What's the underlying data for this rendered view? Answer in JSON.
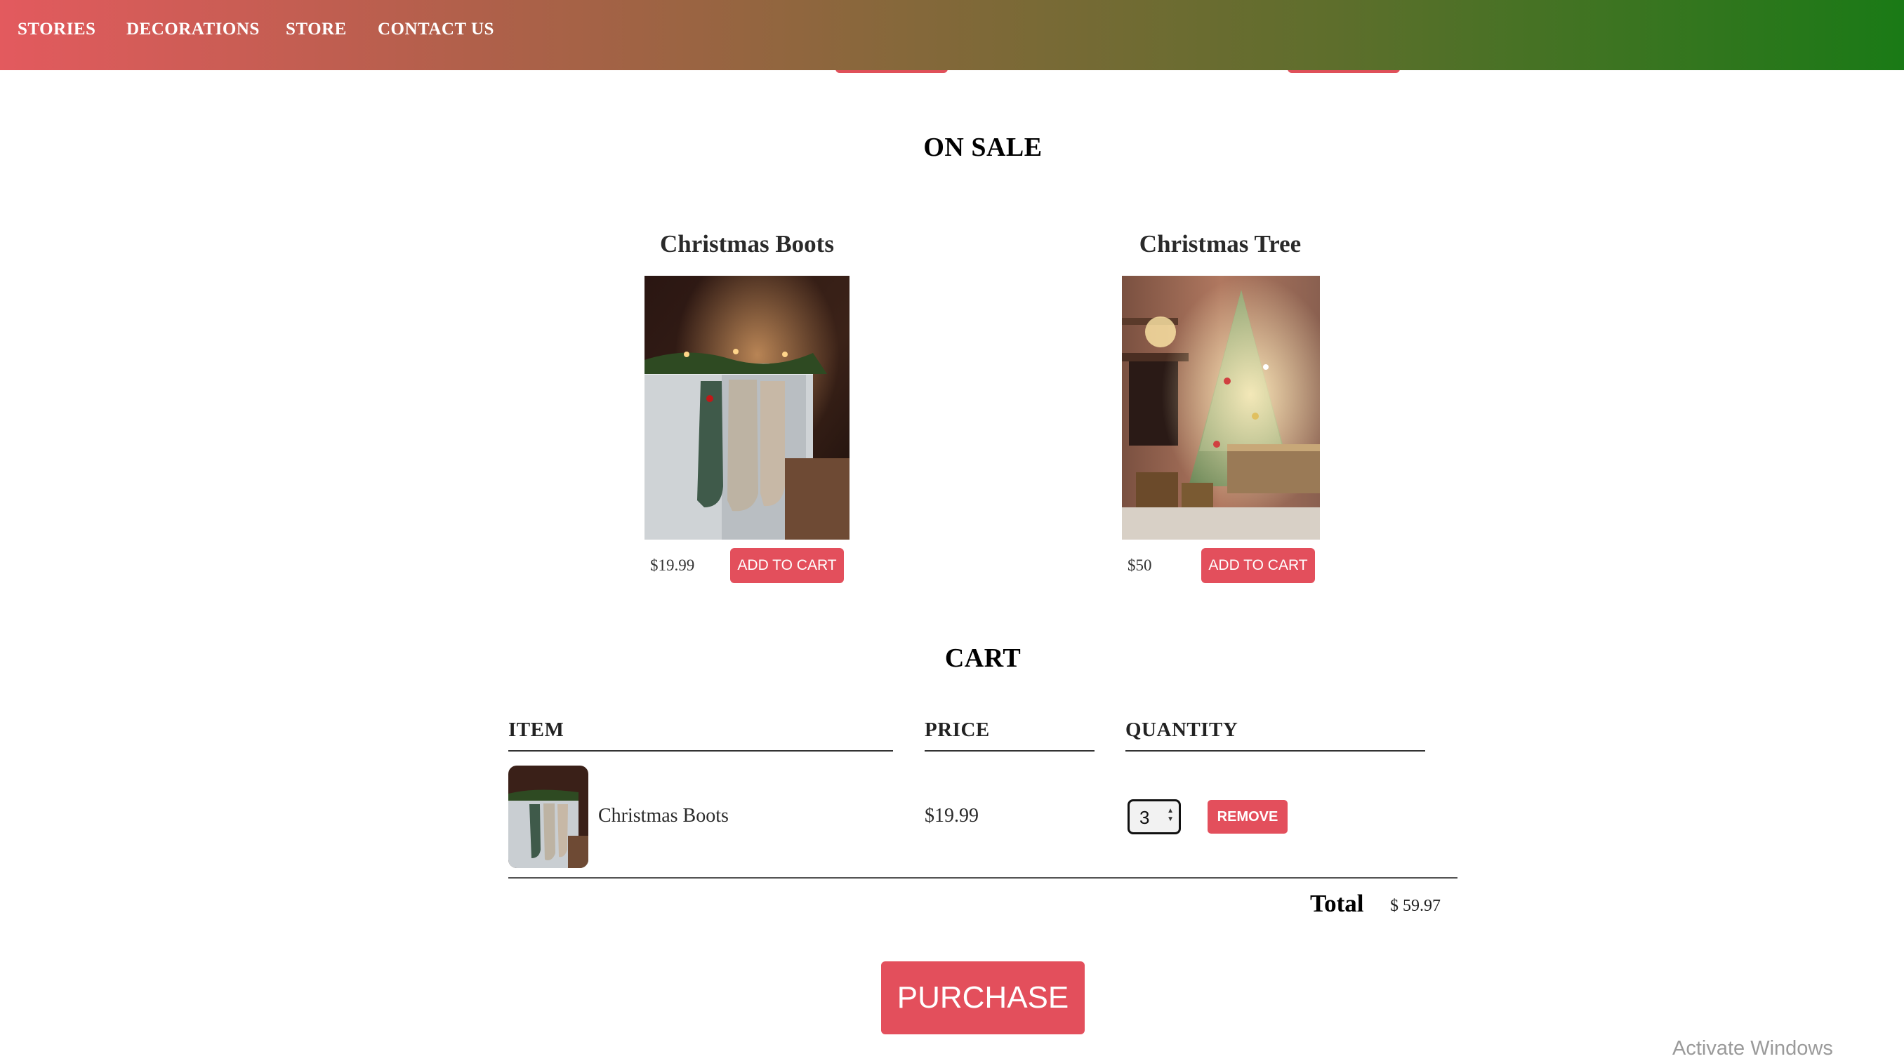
{
  "nav": {
    "items": [
      {
        "label": "STORIES"
      },
      {
        "label": "DECORATIONS"
      },
      {
        "label": "STORE"
      },
      {
        "label": "CONTACT US"
      }
    ]
  },
  "on_sale": {
    "title": "ON SALE",
    "products": [
      {
        "name": "Christmas Boots",
        "price": "$19.99",
        "button_label": "ADD TO CART"
      },
      {
        "name": "Christmas Tree",
        "price": "$50",
        "button_label": "ADD TO CART"
      }
    ]
  },
  "cart": {
    "title": "CART",
    "headers": {
      "item": "ITEM",
      "price": "PRICE",
      "quantity": "QUANTITY"
    },
    "rows": [
      {
        "item": "Christmas Boots",
        "price": "$19.99",
        "quantity": "3",
        "remove_label": "REMOVE"
      }
    ],
    "total_label": "Total",
    "total_value": "$ 59.97",
    "purchase_label": "PURCHASE"
  },
  "os": {
    "watermark": "Activate Windows"
  },
  "colors": {
    "nav_gradient_start": "#e35a5e",
    "nav_gradient_end": "#1a7a16",
    "button": "#e34f5c"
  }
}
